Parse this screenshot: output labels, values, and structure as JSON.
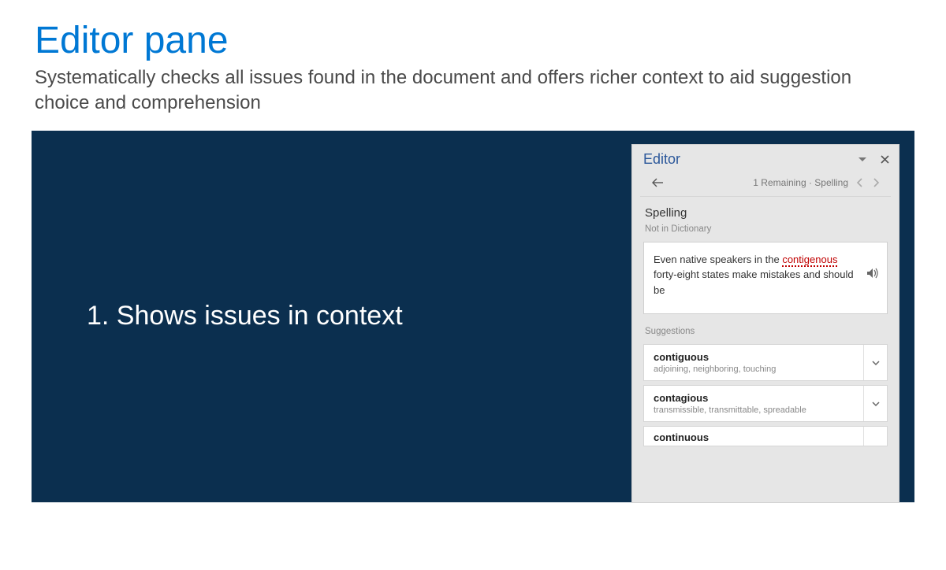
{
  "title": "Editor pane",
  "subtitle": "Systematically checks all issues found in the document and offers richer context to aid suggestion choice and comprehension",
  "caption": "1. Shows issues in context",
  "pane": {
    "title": "Editor",
    "remaining": "1 Remaining · Spelling",
    "sectionTitle": "Spelling",
    "sectionSubtle": "Not in Dictionary",
    "context_pre": "Even native speakers in the ",
    "context_error": "contigenous",
    "context_post": " forty-eight states make mistakes and should be",
    "suggHeader": "Suggestions",
    "suggestions": [
      {
        "word": "contiguous",
        "synonyms": "adjoining, neighboring, touching"
      },
      {
        "word": "contagious",
        "synonyms": "transmissible, transmittable, spreadable"
      },
      {
        "word": "continuous",
        "synonyms": ""
      }
    ]
  }
}
